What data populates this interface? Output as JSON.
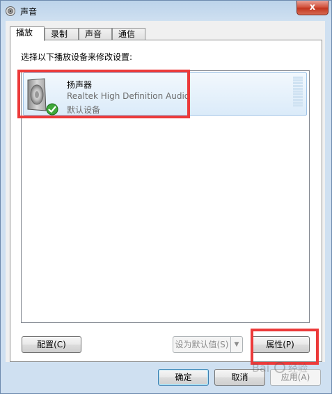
{
  "window": {
    "title": "声音",
    "close_glyph": "x"
  },
  "tabs": [
    {
      "label": "播放"
    },
    {
      "label": "录制"
    },
    {
      "label": "声音"
    },
    {
      "label": "通信"
    }
  ],
  "panel": {
    "instruction": "选择以下播放设备来修改设置:"
  },
  "devices": [
    {
      "name": "扬声器",
      "description": "Realtek High Definition Audio",
      "status": "默认设备",
      "icon": "speaker-icon",
      "badge": "default-check-icon"
    }
  ],
  "buttons": {
    "configure": "配置(C)",
    "set_default": "设为默认值(S)",
    "properties": "属性(P)",
    "ok": "确定",
    "cancel": "取消",
    "apply": "应用(A)"
  },
  "highlight_color": "#ec3a3a",
  "watermark": "Baidu 经验"
}
